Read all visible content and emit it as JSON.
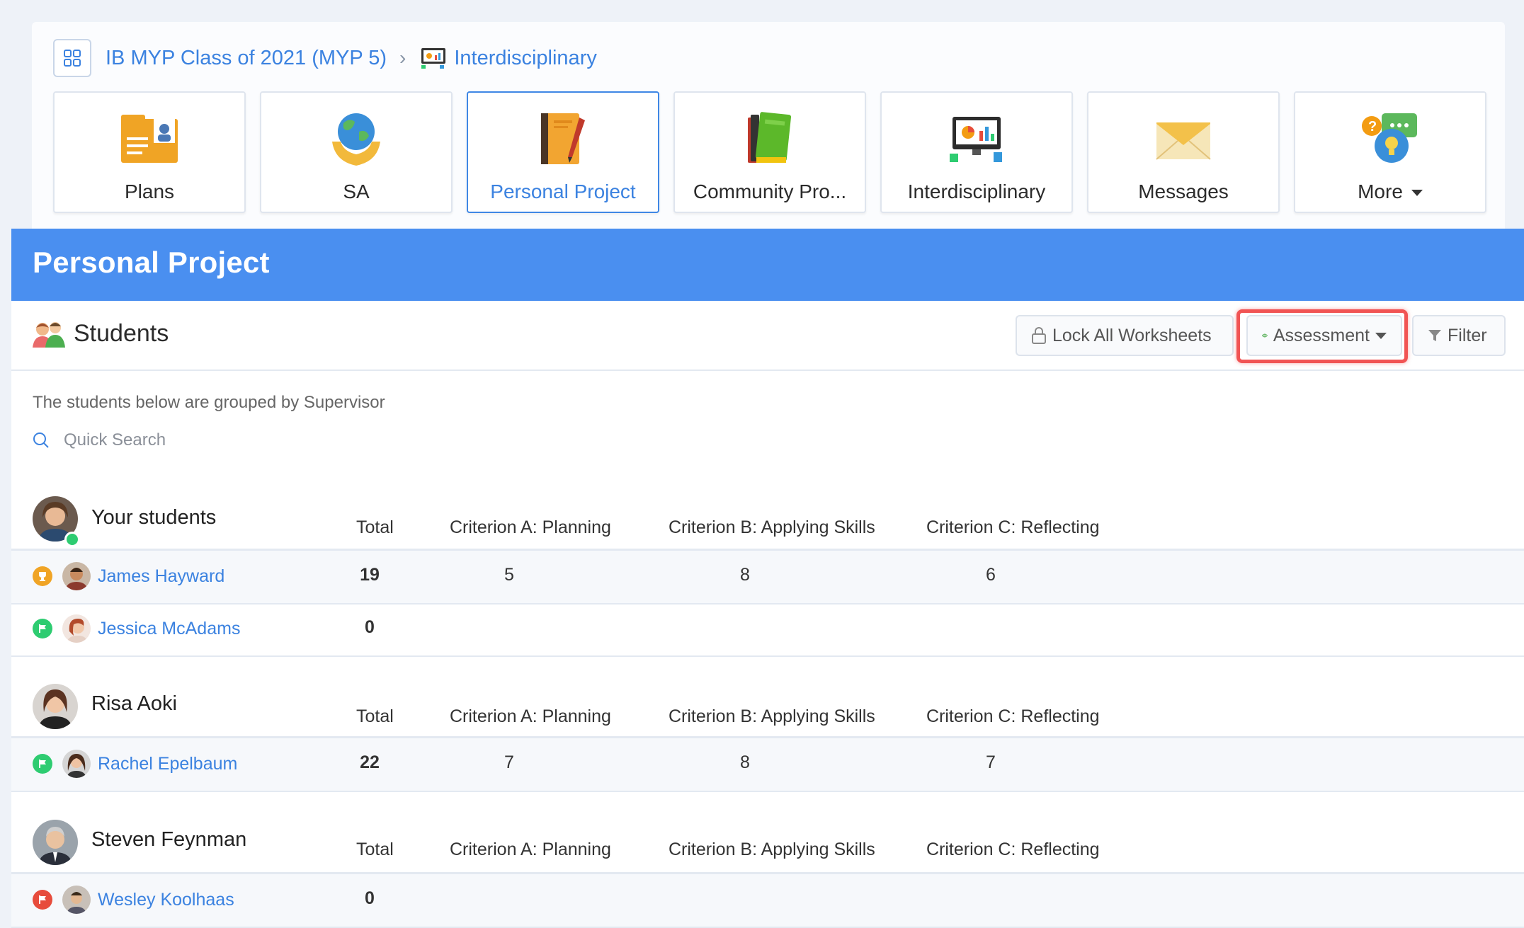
{
  "breadcrumb": {
    "class_name": "IB MYP Class of 2021 (MYP 5)",
    "current": "Interdisciplinary"
  },
  "tiles": [
    {
      "label": "Plans",
      "icon": "plans-folder-icon"
    },
    {
      "label": "SA",
      "icon": "globe-hands-icon"
    },
    {
      "label": "Personal Project",
      "icon": "notebook-icon",
      "active": true
    },
    {
      "label": "Community Pro...",
      "icon": "books-icon"
    },
    {
      "label": "Interdisciplinary",
      "icon": "monitor-chart-icon"
    },
    {
      "label": "Messages",
      "icon": "envelope-icon"
    },
    {
      "label": "More",
      "icon": "chat-bubbles-icon"
    }
  ],
  "header": {
    "title": "Personal Project"
  },
  "toolbar": {
    "title": "Students",
    "lock_label": "Lock All Worksheets",
    "assessment_label": "Assessment",
    "filter_label": "Filter"
  },
  "note": "The students below are grouped by Supervisor",
  "search": {
    "placeholder": "Quick Search"
  },
  "columns": {
    "total": "Total",
    "a": "Criterion A: Planning",
    "b": "Criterion B: Applying Skills",
    "c": "Criterion C: Reflecting"
  },
  "groups": [
    {
      "supervisor": "Your students",
      "students": [
        {
          "name": "James Hayward",
          "status": "trophy",
          "total": "19",
          "a": "5",
          "b": "8",
          "c": "6"
        },
        {
          "name": "Jessica McAdams",
          "status": "flag-green",
          "total": "0",
          "a": "",
          "b": "",
          "c": ""
        }
      ]
    },
    {
      "supervisor": "Risa Aoki",
      "students": [
        {
          "name": "Rachel Epelbaum",
          "status": "flag-green",
          "total": "22",
          "a": "7",
          "b": "8",
          "c": "7"
        }
      ]
    },
    {
      "supervisor": "Steven Feynman",
      "students": [
        {
          "name": "Wesley Koolhaas",
          "status": "flag-red",
          "total": "0",
          "a": "",
          "b": "",
          "c": ""
        }
      ]
    }
  ],
  "colors": {
    "accent": "#4a8ff0",
    "link": "#3b82e0",
    "highlight": "#f15454",
    "green": "#2ecc71"
  }
}
